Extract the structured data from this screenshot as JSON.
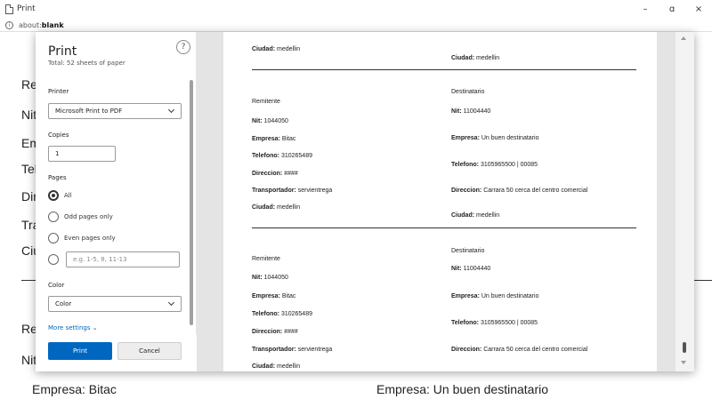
{
  "window": {
    "title": "Print",
    "minimize": "–",
    "maximize": "ɑ",
    "close": "×"
  },
  "address": {
    "prefix": "about:",
    "bold": "blank"
  },
  "background": {
    "labels": [
      "Re",
      "Nit",
      "Em",
      "Tel",
      "Dir",
      "Tra",
      "Ciu",
      "Re",
      "Nit"
    ],
    "empresa_left": "Empresa: Bitac",
    "empresa_right": "Empresa: Un buen destinatario"
  },
  "print_panel": {
    "title": "Print",
    "subtitle": "Total: 52 sheets of paper",
    "help": "?",
    "printer_label": "Printer",
    "printer_value": "Microsoft Print to PDF",
    "copies_label": "Copies",
    "copies_value": "1",
    "pages_label": "Pages",
    "pages_options": [
      "All",
      "Odd pages only",
      "Even pages only"
    ],
    "pages_custom_placeholder": "e.g. 1-5, 8, 11-13",
    "color_label": "Color",
    "color_value": "Color",
    "more_settings": "More settings ⌄",
    "print_button": "Print",
    "cancel_button": "Cancel"
  },
  "preview": {
    "top": {
      "ciudad_left_label": "Ciudad:",
      "ciudad_left_value": "medellin",
      "ciudad_right_label": "Ciudad:",
      "ciudad_right_value": "medellin"
    },
    "block1": {
      "remitente": "Remitente",
      "nit_label": "Nit:",
      "nit_value": "1044050",
      "empresa_label": "Empresa:",
      "empresa_value": "Bitac",
      "telefono_label": "Telefono:",
      "telefono_value": "310265489",
      "direccion_label": "Direccion:",
      "direccion_value": "####",
      "transportador_label": "Transportador:",
      "transportador_value": "servientrega",
      "ciudad_label": "Ciudad:",
      "ciudad_value": "medellin",
      "destinatario": "Destinatario",
      "d_nit_label": "Nit:",
      "d_nit_value": "11004440",
      "d_empresa_label": "Empresa:",
      "d_empresa_value": "Un buen destinatario",
      "d_telefono_label": "Telefono:",
      "d_telefono_value": "3105965500 | 00085",
      "d_direccion_label": "Direccion:",
      "d_direccion_value": "Carrara 50 cerca del centro comercial",
      "d_ciudad_label": "Ciudad:",
      "d_ciudad_value": "medellin"
    },
    "block2": {
      "remitente": "Remitente",
      "nit_label": "Nit:",
      "nit_value": "1044050",
      "empresa_label": "Empresa:",
      "empresa_value": "Bitac",
      "telefono_label": "Telefono:",
      "telefono_value": "310265489",
      "direccion_label": "Direccion:",
      "direccion_value": "####",
      "transportador_label": "Transportador:",
      "transportador_value": "servientrega",
      "ciudad_label": "Ciudad:",
      "ciudad_value": "medellin",
      "destinatario": "Destinatario",
      "d_nit_label": "Nit:",
      "d_nit_value": "11004440",
      "d_empresa_label": "Empresa:",
      "d_empresa_value": "Un buen destinatario",
      "d_telefono_label": "Telefono:",
      "d_telefono_value": "3105965500 | 00085",
      "d_direccion_label": "Direccion:",
      "d_direccion_value": "Carrara 50 cerca del centro comercial"
    }
  }
}
